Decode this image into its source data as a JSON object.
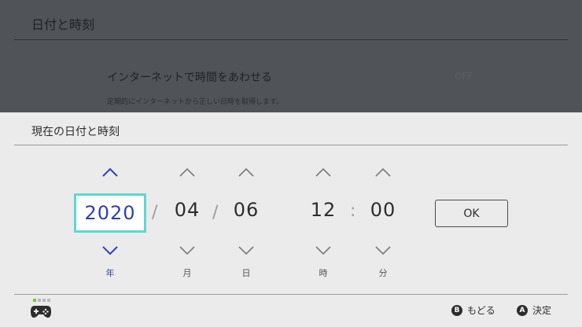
{
  "background": {
    "title": "日付と時刻",
    "setting_label": "インターネットで時間をあわせる",
    "setting_value": "OFF",
    "setting_desc": "定期的にインターネットから正しい日時を取得します。"
  },
  "panel": {
    "title": "現在の日付と時刻",
    "fields": {
      "year": {
        "value": "2020",
        "unit": "年"
      },
      "month": {
        "value": "04",
        "unit": "月"
      },
      "day": {
        "value": "06",
        "unit": "日"
      },
      "hour": {
        "value": "12",
        "unit": "時"
      },
      "minute": {
        "value": "00",
        "unit": "分"
      }
    },
    "date_separator": "/",
    "time_separator": ":",
    "ok_label": "OK",
    "selected_color": "#5bd9d0",
    "selected_text_color": "#2e40b8"
  },
  "footer": {
    "back": {
      "button": "B",
      "label": "もどる"
    },
    "confirm": {
      "button": "A",
      "label": "決定"
    },
    "controller_icon": "controller-icon"
  }
}
